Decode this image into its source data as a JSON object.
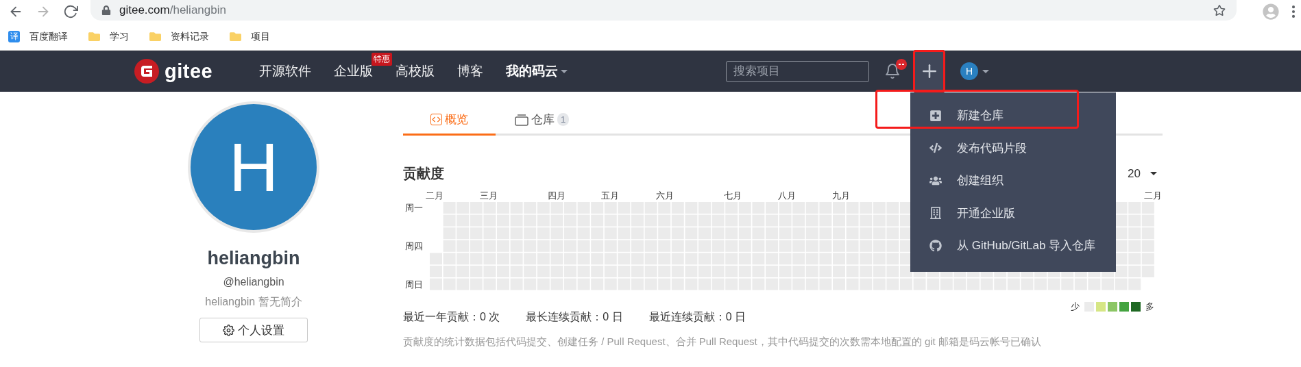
{
  "browser": {
    "back": {
      "disabled": false
    },
    "forward": {
      "disabled": true
    },
    "url_host": "gitee.com",
    "url_path": "/heliangbin"
  },
  "bookmarks": [
    {
      "kind": "app",
      "icon_text": "译",
      "label": "百度翻译"
    },
    {
      "kind": "folder",
      "label": "学习"
    },
    {
      "kind": "folder",
      "label": "资料记录"
    },
    {
      "kind": "folder",
      "label": "项目"
    }
  ],
  "navbar": {
    "brand": "gitee",
    "items": [
      {
        "label": "开源软件",
        "dropdown": false,
        "current": false
      },
      {
        "label": "企业版",
        "badge": "特惠",
        "dropdown": false,
        "current": false
      },
      {
        "label": "高校版",
        "dropdown": false,
        "current": false
      },
      {
        "label": "博客",
        "dropdown": false,
        "current": false
      },
      {
        "label": "我的码云",
        "dropdown": true,
        "current": true
      }
    ],
    "search": {
      "placeholder": "搜索项目"
    },
    "notifications": {
      "unread": true
    },
    "add_button": {
      "highlighted": true
    },
    "avatar": "H"
  },
  "create_menu": {
    "items": [
      {
        "kind": "repo",
        "label": "新建仓库",
        "highlighted": true
      },
      {
        "kind": "snippet",
        "label": "发布代码片段",
        "highlighted": false
      },
      {
        "kind": "org",
        "label": "创建组织",
        "highlighted": false
      },
      {
        "kind": "enterprise",
        "label": "开通企业版",
        "highlighted": false
      },
      {
        "kind": "import",
        "label": "从 GitHub/GitLab 导入仓库",
        "highlighted": false
      }
    ]
  },
  "profile": {
    "avatar": "H",
    "name": "heliangbin",
    "handle": "@heliangbin",
    "bio": "heliangbin 暂无简介",
    "settings_button": "个人设置"
  },
  "tabs": [
    {
      "kind": "overview",
      "label": "概览",
      "selected": true
    },
    {
      "kind": "repos",
      "label": "仓库",
      "count": "1",
      "selected": false
    }
  ],
  "contributions": {
    "title": "贡献度",
    "year": "20",
    "months": [
      "二月",
      "三月",
      "四月",
      "五月",
      "六月",
      "七月",
      "八月",
      "九月",
      "二月"
    ],
    "weekdays": [
      "周一",
      "周四",
      "周日"
    ],
    "legend": {
      "low": "少",
      "high": "多",
      "swatches": [
        {
          "color": "#ebebeb"
        },
        {
          "color": "#d6e685"
        },
        {
          "color": "#8cc665"
        },
        {
          "color": "#44a340"
        },
        {
          "color": "#1e6823"
        }
      ]
    },
    "stats": [
      "最近一年贡献：0 次",
      "最长连续贡献：0 日",
      "最近连续贡献：0 日"
    ],
    "note": "贡献度的统计数据包括代码提交、创建任务 / Pull Request、合并 Pull Request，其中代码提交的次数需本地配置的 git 邮箱是码云帐号已确认"
  }
}
